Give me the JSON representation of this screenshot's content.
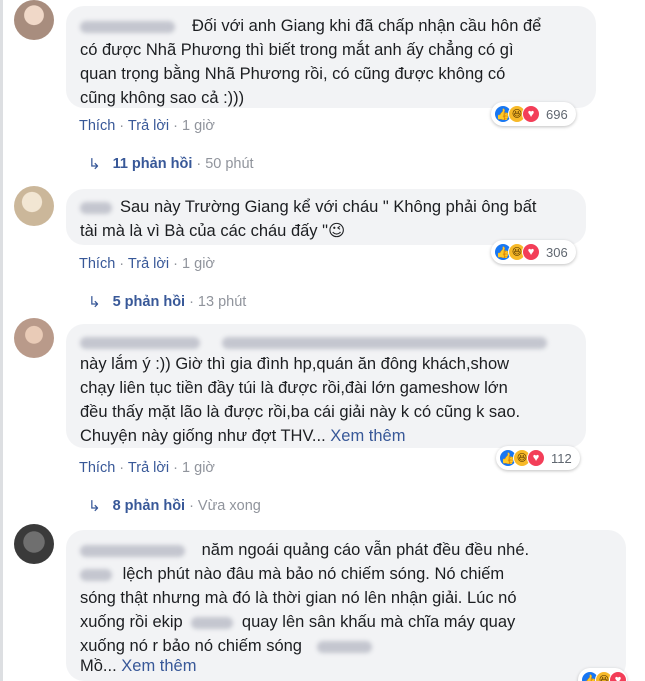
{
  "comments": [
    {
      "text": "Đối với anh Giang khi đã chấp nhận cầu hôn để\ncó được Nhã Phương thì biết trong mắt anh ấy chẳng có gì\nquan trọng bằng Nhã Phương rồi, có cũng được không có\ncũng không sao cả :)))",
      "reaction_count": "696",
      "like_label": "Thích",
      "reply_label": "Trả lời",
      "time": "1 giờ",
      "replies_count": "11 phản hồi",
      "replies_time": "50 phút"
    },
    {
      "text": "Sau này Trường Giang kể với cháu \" Không phải ông bất\ntài mà là vì Bà của các cháu đấy \"😉",
      "reaction_count": "306",
      "like_label": "Thích",
      "reply_label": "Trả lời",
      "time": "1 giờ",
      "replies_count": "5 phản hồi",
      "replies_time": "13 phút"
    },
    {
      "text": "này lắm ý :)) Giờ thì gia đình hp,quán ăn đông khách,show\nchạy liên tục tiền đầy túi là được rồi,đài lớn gameshow lớn\nđều thấy mặt lão là được rồi,ba cái giải này k có cũng k sao.\nChuyện này giống như đợt THV...",
      "see_more": "Xem thêm",
      "reaction_count": "112",
      "like_label": "Thích",
      "reply_label": "Trả lời",
      "time": "1 giờ",
      "replies_count": "8 phản hồi",
      "replies_time": "Vừa xong"
    },
    {
      "line1": "năm ngoái quảng cáo vẫn phát đều đều nhé.",
      "line2": "lệch phút nào đâu mà bảo nó chiếm sóng. Nó chiếm",
      "line3": "sóng thật nhưng mà đó là thời gian nó lên nhận giải. Lúc nó",
      "line4a": "xuống rồi ekip",
      "line4b": "quay lên sân khấu mà chĩa máy quay",
      "line5": "xuống nó r bảo nó chiếm sóng",
      "line6": "Mồ...",
      "see_more": "Xem thêm"
    }
  ],
  "separator": "·",
  "reply_arrow": "↳",
  "colors": {
    "link": "#385898",
    "meta": "#90949c",
    "bubble": "#f2f3f5",
    "like": "#1877f2",
    "haha": "#f7b928",
    "love": "#f33e58"
  }
}
